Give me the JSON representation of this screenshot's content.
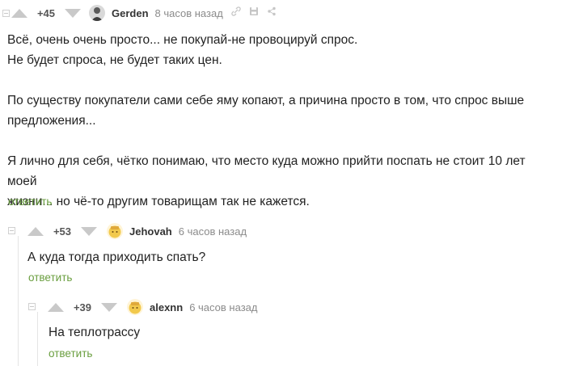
{
  "comments": [
    {
      "rating": "+45",
      "user": "Gerden",
      "time": "8 часов назад",
      "lines": [
        "Всё, очень очень просто... не покупай-не провоцируй спрос.",
        "Не будет спроса, не будет таких цен.",
        "",
        "По существу покупатели сами себе яму копают, а причина просто в том, что спрос выше",
        "предложения...",
        "",
        "Я лично для себя, чётко понимаю, что место куда можно прийти поспать не стоит 10 лет моей",
        "жизни... но чё-то другим товарищам так не кажется."
      ],
      "reply": "ответить"
    },
    {
      "rating": "+53",
      "user": "Jehovah",
      "time": "6 часов назад",
      "lines": [
        "А куда тогда приходить спать?"
      ],
      "reply": "ответить"
    },
    {
      "rating": "+39",
      "user": "alexnn",
      "time": "6 часов назад",
      "lines": [
        "На теплотрассу"
      ],
      "reply": "ответить"
    }
  ],
  "icons": [
    "collapse-icon",
    "upvote-icon",
    "downvote-icon",
    "avatar",
    "link-icon",
    "save-icon",
    "share-icon"
  ],
  "colors": {
    "reply": "#6a9e3f",
    "vote": "#c9c9c9",
    "avatar_yellow": "#f2c94c"
  }
}
